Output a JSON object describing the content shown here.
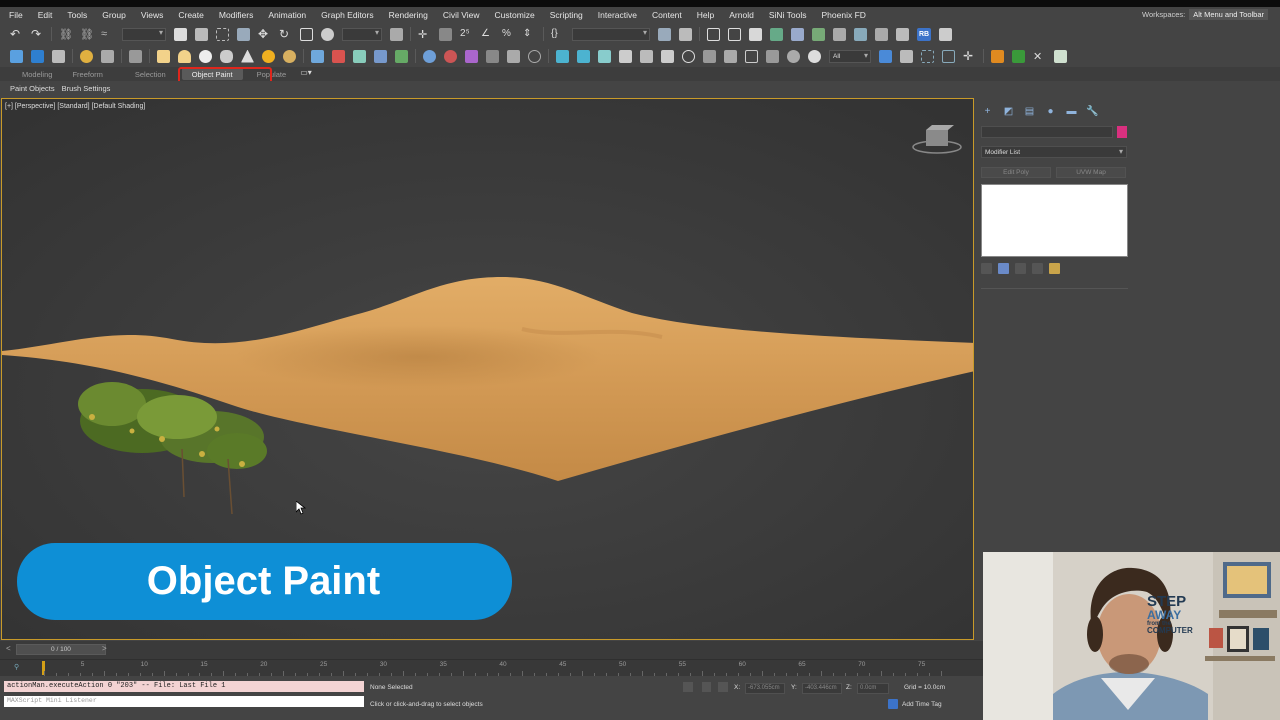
{
  "menu": {
    "items": [
      "File",
      "Edit",
      "Tools",
      "Group",
      "Views",
      "Create",
      "Modifiers",
      "Animation",
      "Graph Editors",
      "Rendering",
      "Civil View",
      "Customize",
      "Scripting",
      "Interactive",
      "Content",
      "Help",
      "Arnold",
      "SiNi Tools",
      "Phoenix FD"
    ],
    "workspaces_label": "Workspaces:",
    "workspaces_value": "Alt Menu and Toolbar"
  },
  "toolbar": {
    "selection_filter": "All",
    "rb_badge": "RB"
  },
  "ribbon": {
    "tabs": [
      "Modeling",
      "Freeform",
      "Selection",
      "Object Paint",
      "Populate"
    ],
    "active_tab": "Object Paint",
    "sub_items": [
      "Paint Objects",
      "Brush Settings"
    ]
  },
  "viewport": {
    "label": "[+] [Perspective] [Standard] [Default Shading]",
    "banner": "Object Paint"
  },
  "command_panel": {
    "modifier_list": "Modifier List",
    "buttons": [
      "Edit Poly",
      "UVW Map"
    ],
    "color_swatch": "#d9307f"
  },
  "timeline": {
    "frame_counter": "0 / 100",
    "ticks": [
      "5",
      "10",
      "15",
      "20",
      "25",
      "30",
      "35",
      "40",
      "45",
      "50",
      "55",
      "60",
      "65",
      "70",
      "75"
    ]
  },
  "status": {
    "maxscript_line": "actionMan.executeAction 0 \"203\"  -- File: Last File 1",
    "maxscript_listener": "MAXScript Mini Listener",
    "selection": "None Selected",
    "prompt": "Click or click-and-drag to select objects",
    "x_label": "X:",
    "x_value": "-673.055cm",
    "y_label": "Y:",
    "y_value": "-403.446cm",
    "z_label": "Z:",
    "z_value": "0.0cm",
    "grid": "Grid = 10.0cm",
    "add_time_tag": "Add Time Tag"
  },
  "webcam": {
    "sign_line1": "STEP",
    "sign_line2": "AWAY",
    "sign_line3": "from the",
    "sign_line4": "COMPUTER"
  },
  "colors": {
    "banner": "#0e8fd6",
    "viewport_border": "#c89a29",
    "highlight": "#e0261c",
    "terrain": "#d39a55"
  }
}
